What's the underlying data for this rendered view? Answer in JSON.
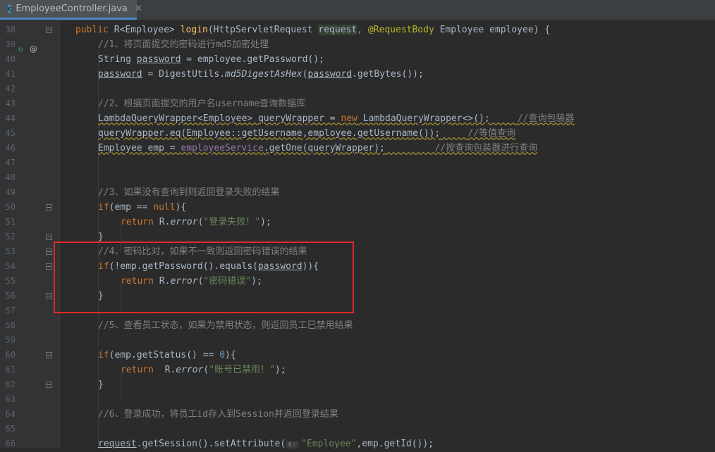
{
  "tab": {
    "title": "EmployeeController.java",
    "close": "✕",
    "icon": "c"
  },
  "gutter": {
    "at_symbol": "@"
  },
  "lines": [
    {
      "n": "38",
      "fold": true
    },
    {
      "n": "39"
    },
    {
      "n": "40"
    },
    {
      "n": "41"
    },
    {
      "n": "42"
    },
    {
      "n": "43"
    },
    {
      "n": "44"
    },
    {
      "n": "45"
    },
    {
      "n": "46"
    },
    {
      "n": "47"
    },
    {
      "n": "48"
    },
    {
      "n": "49"
    },
    {
      "n": "50",
      "fold": true
    },
    {
      "n": "51"
    },
    {
      "n": "52",
      "fold": true
    },
    {
      "n": "53",
      "fold": true
    },
    {
      "n": "54",
      "fold": true
    },
    {
      "n": "55"
    },
    {
      "n": "56",
      "fold": true
    },
    {
      "n": "57"
    },
    {
      "n": "58"
    },
    {
      "n": "59"
    },
    {
      "n": "60",
      "fold": true
    },
    {
      "n": "61"
    },
    {
      "n": "62",
      "fold": true
    },
    {
      "n": "63"
    },
    {
      "n": "64"
    },
    {
      "n": "65"
    },
    {
      "n": "66"
    }
  ],
  "code": {
    "l38": {
      "kw": "public",
      "a": " R<Employee> ",
      "fn": "login",
      "b": "(HttpServletRequest ",
      "param": "request",
      "c": ", ",
      "ann": "@RequestBody",
      "d": " Employee employee) {"
    },
    "l39": "//1、将页面提交的密码进行md5加密处理",
    "l40": {
      "a": "String ",
      "var": "password",
      "b": " = employee.getPassword();"
    },
    "l41": {
      "var": "password",
      "a": " = DigestUtils.",
      "m": "md5DigestAsHex",
      "b": "(",
      "var2": "password",
      "c": ".getBytes());"
    },
    "l43": "//2、根据页面提交的用户名username查询数据库",
    "l44": {
      "a": "LambdaQueryWrapper<Employee> queryWrapper = ",
      "kw": "new",
      "b": " LambdaQueryWrapper<>();",
      "cm": "//查询包装器"
    },
    "l45": {
      "a": "queryWrapper.eq(Employee::getUsername,employee.getUsername());",
      "cm": "//等值查询"
    },
    "l46": {
      "a": "Employee emp = ",
      "fld": "employeeService",
      "b": ".getOne(queryWrapper);",
      "cm": "//按查询包装器进行查询"
    },
    "l49": "//3、如果没有查询到则返回登录失败的结果",
    "l50": {
      "kw": "if",
      "a": "(emp == ",
      "kw2": "null",
      "b": "){"
    },
    "l51": {
      "kw": "return",
      "a": " R.",
      "m": "error",
      "b": "(",
      "str": "\"登录失败！\"",
      "c": ");"
    },
    "l52": "}",
    "l53": "//4、密码比对，如果不一致则返回密码错误的结果",
    "l54": {
      "kw": "if",
      "a": "(!emp.getPassword().equals(",
      "var": "password",
      "b": ")){"
    },
    "l55": {
      "kw": "return",
      "a": " R.",
      "m": "error",
      "b": "(",
      "str": "\"密码错误\"",
      "c": ");"
    },
    "l56": "}",
    "l58": "//5、查看员工状态，如果为禁用状态，则返回员工已禁用结果",
    "l60": {
      "kw": "if",
      "a": "(emp.getStatus() == ",
      "num": "0",
      "b": "){"
    },
    "l61": {
      "kw": "return",
      "a": "  R.",
      "m": "error",
      "b": "(",
      "str": "\"账号已禁用！\"",
      "c": ");"
    },
    "l62": "}",
    "l64": "//6、登录成功，将员工id存入到Session并返回登录结果",
    "l66": {
      "var": "request",
      "a": ".getSession().setAttribute(",
      "hint": "s:",
      "str": "\"Employee\"",
      "b": ",emp.getId());"
    }
  },
  "colors": {
    "background": "#2b2b2b",
    "gutter": "#313335",
    "highlight": "#e0292b",
    "keyword": "#cc7832",
    "comment": "#808080",
    "string": "#6a8759"
  }
}
